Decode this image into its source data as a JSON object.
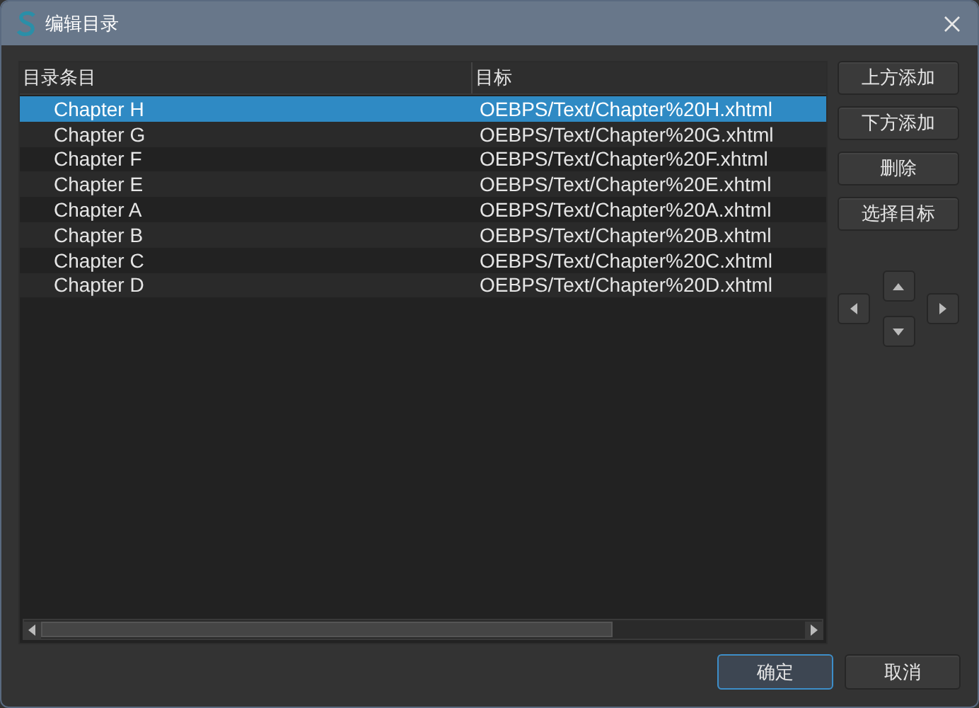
{
  "window": {
    "title": "编辑目录"
  },
  "table": {
    "columns": [
      "目录条目",
      "目标"
    ],
    "rows": [
      {
        "entry": "Chapter H",
        "target": "OEBPS/Text/Chapter%20H.xhtml",
        "selected": true
      },
      {
        "entry": "Chapter G",
        "target": "OEBPS/Text/Chapter%20G.xhtml",
        "selected": false
      },
      {
        "entry": "Chapter F",
        "target": "OEBPS/Text/Chapter%20F.xhtml",
        "selected": false
      },
      {
        "entry": "Chapter E",
        "target": "OEBPS/Text/Chapter%20E.xhtml",
        "selected": false
      },
      {
        "entry": "Chapter A",
        "target": "OEBPS/Text/Chapter%20A.xhtml",
        "selected": false
      },
      {
        "entry": "Chapter B",
        "target": "OEBPS/Text/Chapter%20B.xhtml",
        "selected": false
      },
      {
        "entry": "Chapter C",
        "target": "OEBPS/Text/Chapter%20C.xhtml",
        "selected": false
      },
      {
        "entry": "Chapter D",
        "target": "OEBPS/Text/Chapter%20D.xhtml",
        "selected": false
      }
    ]
  },
  "side_buttons": [
    "上方添加",
    "下方添加",
    "删除",
    "选择目标"
  ],
  "footer_buttons": [
    {
      "label": "确定",
      "default": true
    },
    {
      "label": "取消",
      "default": false
    }
  ]
}
